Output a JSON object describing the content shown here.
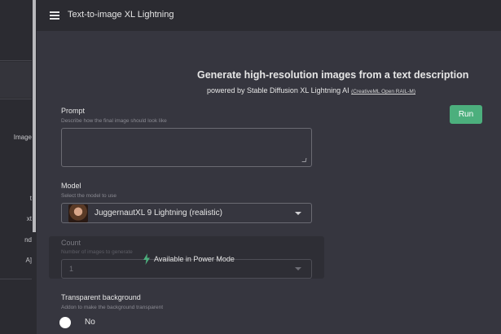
{
  "topbar": {
    "title": "Text-to-image XL Lightning"
  },
  "sidebar": {
    "items": [
      "Image",
      "t",
      "xt",
      "nd",
      "A]"
    ]
  },
  "header": {
    "title": "Generate high-resolution images from a text description",
    "subtitle": "powered by Stable Diffusion XL Lightning AI",
    "license_link": "(CreativeML Open RAIL-M)"
  },
  "run_label": "Run",
  "prompt": {
    "label": "Prompt",
    "hint": "Describe how the final image should look like",
    "value": ""
  },
  "model": {
    "label": "Model",
    "hint": "Select the model to use",
    "selected": "JuggernautXL 9 Lightning (realistic)"
  },
  "count": {
    "label": "Count",
    "hint": "Number of images to generate",
    "value": "1",
    "lock_message": "Available in Power Mode"
  },
  "transparent": {
    "label": "Transparent background",
    "hint": "Addon to make the background transparent",
    "value": "No"
  },
  "colors": {
    "accent": "#4caf7d",
    "background": "#36363f",
    "panel": "#2b2b31",
    "power_bolt": "#4caf7d"
  },
  "icons": [
    "menu-icon",
    "chevron-down-icon",
    "lightning-icon"
  ]
}
